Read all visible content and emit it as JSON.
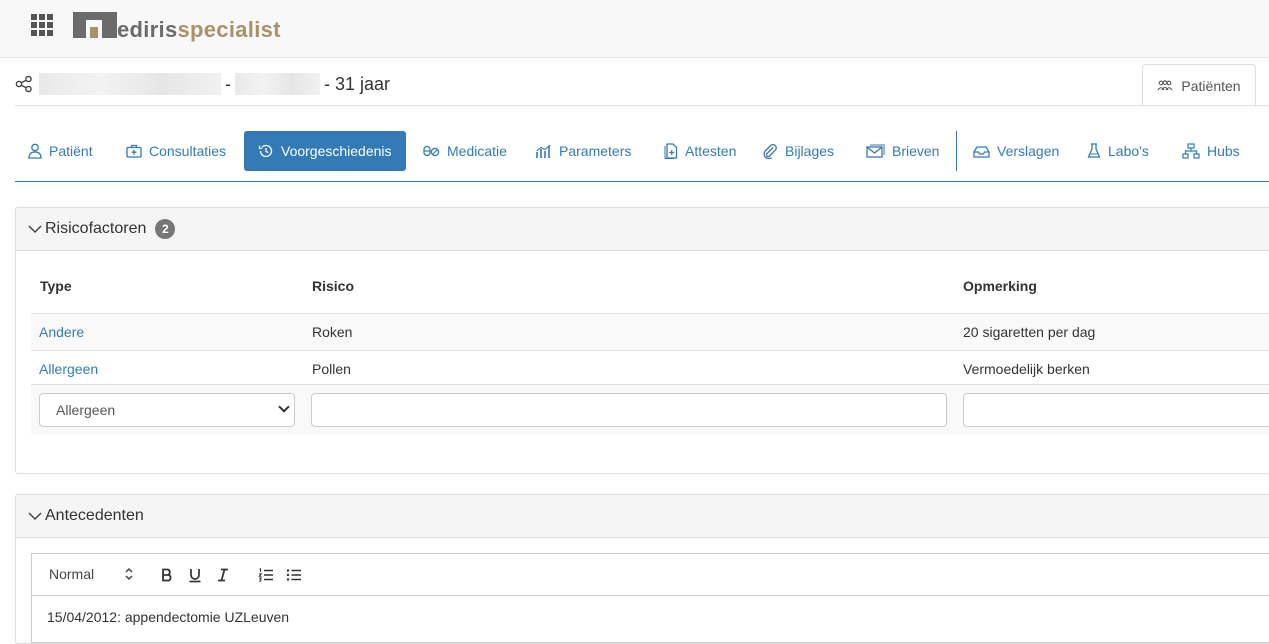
{
  "brand": {
    "name_part1": "ediris",
    "name_part2": "specialist"
  },
  "patient": {
    "separator": "-",
    "age": "- 31 jaar"
  },
  "patients_tab": {
    "label": "Patiënten"
  },
  "nav": [
    {
      "id": "patient",
      "label": "Patiënt",
      "icon": "user-icon"
    },
    {
      "id": "consultaties",
      "label": "Consultaties",
      "icon": "medical-bag-icon"
    },
    {
      "id": "voorgeschiedenis",
      "label": "Voorgeschiedenis",
      "icon": "history-icon",
      "active": true
    },
    {
      "id": "medicatie",
      "label": "Medicatie",
      "icon": "pills-icon"
    },
    {
      "id": "parameters",
      "label": "Parameters",
      "icon": "chart-icon"
    },
    {
      "id": "attesten",
      "label": "Attesten",
      "icon": "document-plus-icon"
    },
    {
      "id": "bijlages",
      "label": "Bijlages",
      "icon": "paperclip-icon"
    },
    {
      "id": "brieven",
      "label": "Brieven",
      "icon": "letter-icon"
    },
    {
      "id": "verslagen",
      "label": "Verslagen",
      "icon": "inbox-icon"
    },
    {
      "id": "labos",
      "label": "Labo's",
      "icon": "flask-icon"
    },
    {
      "id": "hubs",
      "label": "Hubs",
      "icon": "network-icon"
    }
  ],
  "risk": {
    "title": "Risicofactoren",
    "count": "2",
    "columns": {
      "type": "Type",
      "risico": "Risico",
      "opmerking": "Opmerking"
    },
    "rows": [
      {
        "type": "Andere",
        "risico": "Roken",
        "opmerking": "20 sigaretten per dag"
      },
      {
        "type": "Allergeen",
        "risico": "Pollen",
        "opmerking": "Vermoedelijk berken"
      }
    ],
    "new_row": {
      "type_value": "Allergeen",
      "risico_value": "",
      "opmerking_value": ""
    }
  },
  "antecedents": {
    "title": "Antecedenten",
    "editor": {
      "format": "Normal",
      "content": "15/04/2012: appendectomie UZLeuven"
    }
  },
  "colors": {
    "accent": "#337ab7",
    "brand_gray": "#6b6b6b",
    "brand_gold": "#a8926a"
  }
}
